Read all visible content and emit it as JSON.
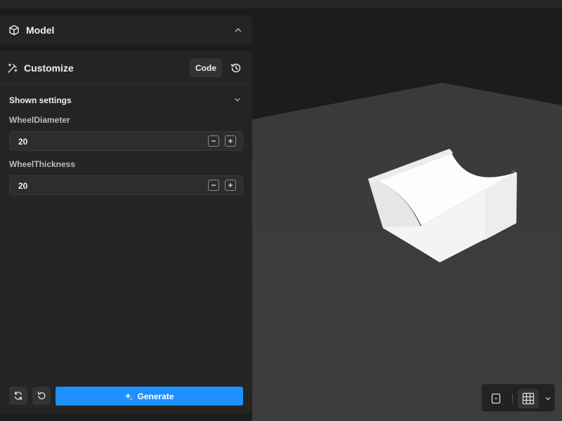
{
  "model_panel": {
    "title": "Model",
    "icon": "cube-icon"
  },
  "customize_panel": {
    "title": "Customize",
    "icon": "magic-wand-icon",
    "code_label": "Code",
    "history_icon": "history-icon"
  },
  "shown_settings": {
    "label": "Shown settings",
    "params": [
      {
        "label": "WheelDiameter",
        "value": "20"
      },
      {
        "label": "WheelThickness",
        "value": "20"
      }
    ]
  },
  "footer": {
    "generate_label": "Generate",
    "generate_icon": "sparkle-icon",
    "accent_color": "#1e90ff"
  },
  "view_controls": {
    "icons": [
      "camera-frame-icon",
      "grid-icon",
      "chevron-down-icon"
    ]
  }
}
